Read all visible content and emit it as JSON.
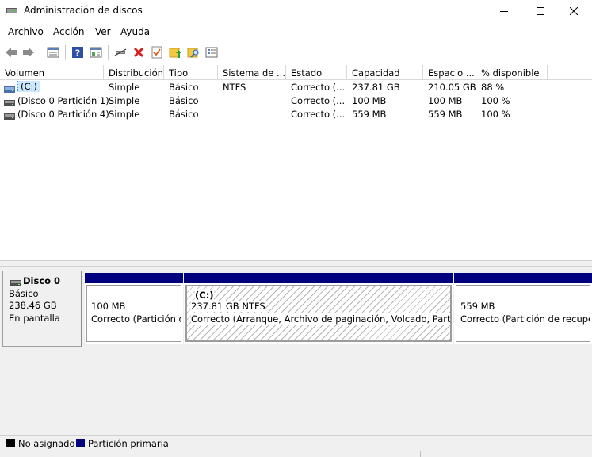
{
  "window": {
    "title": "Administración de discos"
  },
  "menu": [
    "Archivo",
    "Acción",
    "Ver",
    "Ayuda"
  ],
  "toolbar_icons": [
    "back-arrow-icon",
    "forward-arrow-icon",
    "disk-list-icon",
    "help-icon",
    "properties-icon",
    "connect-icon",
    "delete-icon",
    "check-icon",
    "up-folder-icon",
    "search-folder-icon",
    "settings-list-icon"
  ],
  "volumes": {
    "columns": [
      "Volumen",
      "Distribución",
      "Tipo",
      "Sistema de ...",
      "Estado",
      "Capacidad",
      "Espacio ...",
      "% disponible"
    ],
    "rows": [
      {
        "name": "(C:)",
        "layout": "Simple",
        "type": "Básico",
        "fs": "NTFS",
        "status": "Correcto (...",
        "capacity": "237.81 GB",
        "free": "210.05 GB",
        "pct": "88 %"
      },
      {
        "name": "(Disco 0 Partición 1)",
        "layout": "Simple",
        "type": "Básico",
        "fs": "",
        "status": "Correcto (...",
        "capacity": "100 MB",
        "free": "100 MB",
        "pct": "100 %"
      },
      {
        "name": "(Disco 0 Partición 4)",
        "layout": "Simple",
        "type": "Básico",
        "fs": "",
        "status": "Correcto (...",
        "capacity": "559 MB",
        "free": "559 MB",
        "pct": "100 %"
      }
    ]
  },
  "disk": {
    "name": "Disco 0",
    "type": "Básico",
    "size": "238.46 GB",
    "state": "En pantalla"
  },
  "partitions": [
    {
      "label": "",
      "size": "100 MB",
      "status": "Correcto (Partición d"
    },
    {
      "label": "(C:)",
      "size": "237.81 GB NTFS",
      "status": "Correcto (Arranque, Archivo de paginación, Volcado, Partición"
    },
    {
      "label": "",
      "size": "559 MB",
      "status": "Correcto (Partición de recuper"
    }
  ],
  "legend": {
    "unallocated": "No asignado",
    "primary": "Partición primaria"
  },
  "colors": {
    "primary_partition": "#00007f",
    "unallocated": "#000000",
    "selection": "#cce8ff"
  }
}
